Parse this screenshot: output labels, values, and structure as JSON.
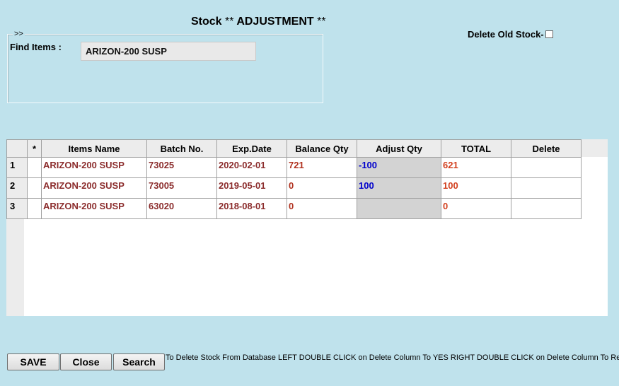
{
  "header": {
    "title_part1": "Stock ",
    "title_stars1": "**",
    "title_part2": " ADJUSTMENT ",
    "title_stars2": "**"
  },
  "find": {
    "legend": ">>",
    "label": "Find Items :",
    "value": "ARIZON-200 SUSP"
  },
  "delete_old_stock": {
    "label": "Delete Old Stock-",
    "checked": false
  },
  "grid": {
    "columns": [
      "*",
      "Items Name",
      "Batch No.",
      "Exp.Date",
      "Balance Qty",
      "Adjust Qty",
      "TOTAL",
      "Delete"
    ],
    "rows": [
      {
        "num": "1",
        "item": "ARIZON-200 SUSP",
        "batch": "73025",
        "exp": "2020-02-01",
        "balance": "721",
        "adjust": "-100",
        "total": "621",
        "delete": ""
      },
      {
        "num": "2",
        "item": "ARIZON-200 SUSP",
        "batch": "73005",
        "exp": "2019-05-01",
        "balance": "0",
        "adjust": "100",
        "total": "100",
        "delete": ""
      },
      {
        "num": "3",
        "item": "ARIZON-200 SUSP",
        "batch": "63020",
        "exp": "2018-08-01",
        "balance": "0",
        "adjust": "",
        "total": "0",
        "delete": ""
      }
    ]
  },
  "buttons": {
    "save": "SAVE",
    "close": "Close",
    "search": "Search"
  },
  "hint": "To Delete Stock From Database  LEFT DOUBLE CLICK on Delete Column To YES  RIGHT DOUBLE CLICK on Delete Column To Reset as N"
}
